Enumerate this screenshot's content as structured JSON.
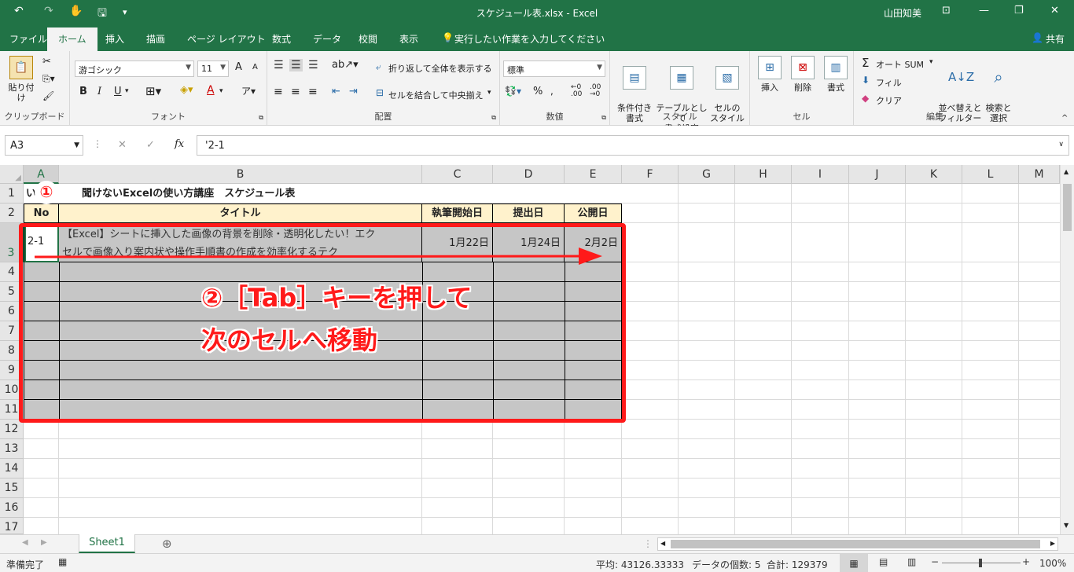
{
  "window": {
    "title": "スケジュール表.xlsx  -  Excel",
    "user": "山田知美"
  },
  "qat": {
    "undo": "↶",
    "redo": "↷",
    "touch": "✋",
    "save": "🖫",
    "customize": "▾"
  },
  "tabs": [
    "ファイル",
    "ホーム",
    "挿入",
    "描画",
    "ページ レイアウト",
    "数式",
    "データ",
    "校閲",
    "表示"
  ],
  "tell_me": "実行したい作業を入力してください",
  "share": "共有",
  "ribbon": {
    "clipboard": {
      "label": "クリップボード",
      "paste": "貼り付け"
    },
    "font": {
      "label": "フォント",
      "name": "游ゴシック",
      "size": "11",
      "bold": "B",
      "italic": "I",
      "underline": "U",
      "grow": "A",
      "shrink": "A"
    },
    "alignment": {
      "label": "配置",
      "wrap": "折り返して全体を表示する",
      "merge": "セルを結合して中央揃え"
    },
    "number": {
      "label": "数値",
      "format": "標準",
      "percent": "%"
    },
    "styles": {
      "label": "スタイル",
      "conditional": "条件付き\n書式",
      "table": "テーブルとして\n書式設定",
      "cell": "セルの\nスタイル"
    },
    "cells": {
      "label": "セル",
      "insert": "挿入",
      "delete": "削除",
      "format": "書式"
    },
    "editing": {
      "label": "編集",
      "autosum": "オート SUM",
      "fill": "フィル",
      "clear": "クリア",
      "sort": "並べ替えと\nフィルター",
      "find": "検索と\n選択"
    }
  },
  "formula_bar": {
    "name_box": "A3",
    "cancel": "✕",
    "enter": "✓",
    "fx": "fx",
    "content": "'2-1"
  },
  "columns": [
    "A",
    "B",
    "C",
    "D",
    "E",
    "F",
    "G",
    "H",
    "I",
    "J",
    "K",
    "L",
    "M"
  ],
  "rows": [
    "1",
    "2",
    "3",
    "4",
    "5",
    "6",
    "7",
    "8",
    "9",
    "10",
    "11",
    "12",
    "13",
    "14",
    "15",
    "16",
    "17"
  ],
  "sheet": {
    "title_cell": "いまさら聞けないExcelの使い方講座　スケジュール表",
    "title_cell_visible_start": "い",
    "title_cell_visible_rest": "聞けないExcelの使い方講座　スケジュール表",
    "headers": [
      "No",
      "タイトル",
      "執筆開始日",
      "提出日",
      "公開日"
    ],
    "row3": {
      "no": "2-1",
      "title_line1": "【Excel】シートに挿入した画像の背景を削除・透明化したい！エク",
      "title_line2": "セルで画像入り案内状や操作手順書の作成を効率化するテク",
      "start": "1月22日",
      "submit": "1月24日",
      "publish": "2月2日"
    }
  },
  "annotations": {
    "step1": "①",
    "step2_line1": "②［Tab］キーを押して",
    "step2_line2": "次のセルへ移動",
    "accent": "#ff1a1a"
  },
  "sheet_tabs": {
    "active": "Sheet1",
    "add": "⊕"
  },
  "status": {
    "ready": "準備完了",
    "average": "平均: 43126.33333",
    "count": "データの個数: 5",
    "sum": "合計: 129379",
    "zoom": "100%"
  },
  "colors": {
    "brand": "#217346",
    "header_fill": "#fff2cc",
    "selection_fill": "#c6c6c6"
  }
}
